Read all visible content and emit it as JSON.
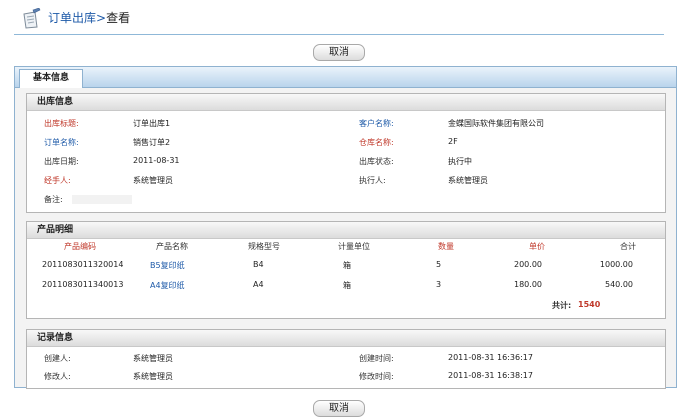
{
  "header": {
    "title": "订单出库",
    "separator": ">",
    "subtitle": "查看",
    "icon": "file-pen-icon"
  },
  "buttons": {
    "cancel_top": "取消",
    "cancel_bottom": "取消"
  },
  "tab": {
    "label": "基本信息"
  },
  "outbound": {
    "heading": "出库信息",
    "title_label": "出库标题:",
    "title_value": "订单出库1",
    "customer_label": "客户名称:",
    "customer_value": "金蝶国际软件集团有限公司",
    "order_label": "订单名称:",
    "order_value": "销售订单2",
    "warehouse_label": "仓库名称:",
    "warehouse_value": "2F",
    "date_label": "出库日期:",
    "date_value": "2011-08-31",
    "status_label": "出库状态:",
    "status_value": "执行中",
    "handler_label": "经手人:",
    "handler_value": "系统管理员",
    "executor_label": "执行人:",
    "executor_value": "系统管理员",
    "note_label": "备注:"
  },
  "products": {
    "heading": "产品明细",
    "columns": [
      "产品编码",
      "产品名称",
      "规格型号",
      "计量单位",
      "数量",
      "单价",
      "合计"
    ],
    "rows": [
      [
        "2011083011320014",
        "B5复印纸",
        "B4",
        "箱",
        "5",
        "200.00",
        "1000.00"
      ],
      [
        "2011083011340013",
        "A4复印纸",
        "A4",
        "箱",
        "3",
        "180.00",
        "540.00"
      ]
    ],
    "total_label": "共计:",
    "total_value": "1540"
  },
  "record": {
    "heading": "记录信息",
    "creator_label": "创建人:",
    "creator_value": "系统管理员",
    "created_label": "创建时间:",
    "created_value": "2011-08-31 16:36:17",
    "modifier_label": "修改人:",
    "modifier_value": "系统管理员",
    "modified_label": "修改时间:",
    "modified_value": "2011-08-31 16:38:17"
  },
  "colors": {
    "label_red": "#c0392b",
    "label_blue": "#1e5aa8",
    "link_blue": "#1e5aa8",
    "frame_border": "#8fb2d0"
  }
}
